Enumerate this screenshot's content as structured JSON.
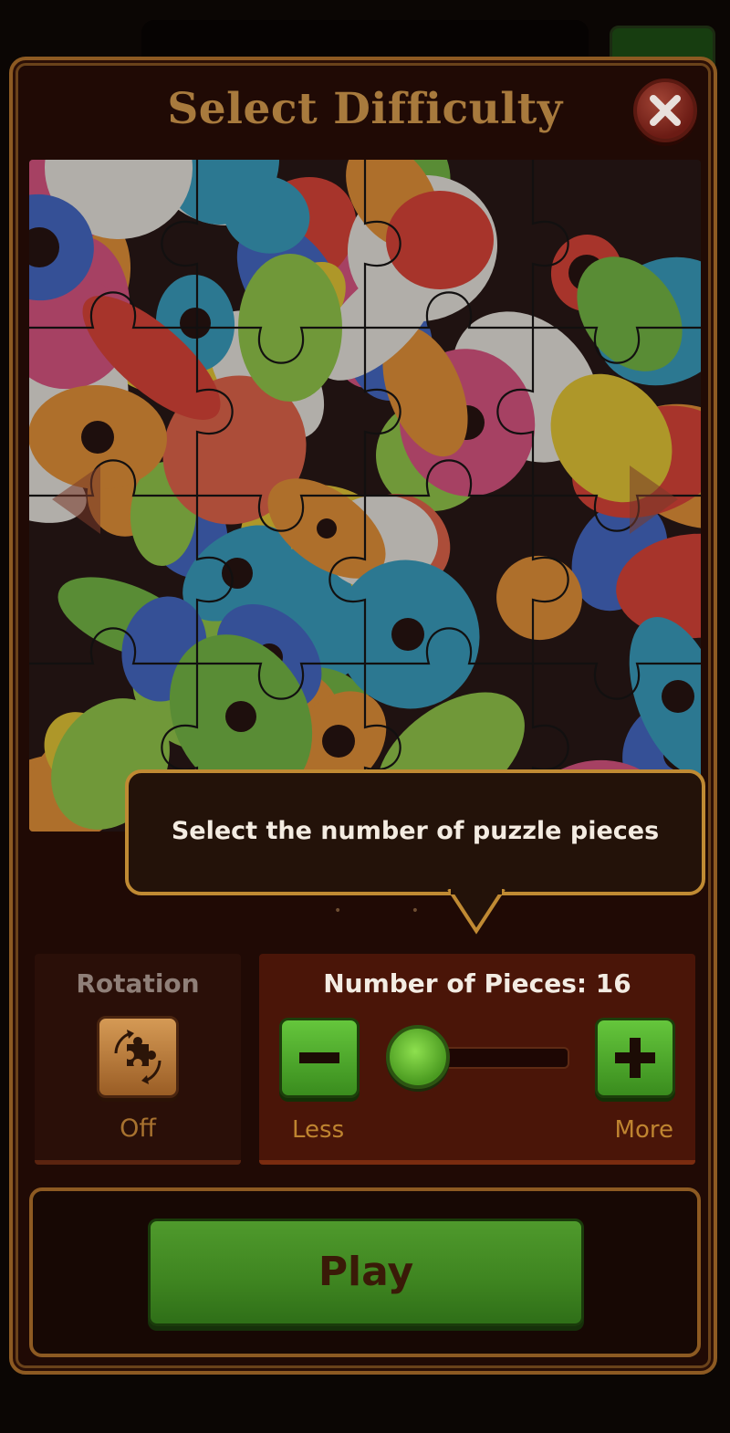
{
  "dialog": {
    "title": "Select Difficulty",
    "close_icon": "close-x-icon"
  },
  "puzzle_preview": {
    "description_icon": "candy-puzzle-image"
  },
  "tooltip": {
    "text": "Select the number of puzzle pieces"
  },
  "rotation": {
    "label": "Rotation",
    "icon": "rotate-piece-icon",
    "state": "Off"
  },
  "pieces": {
    "title": "Number of Pieces: 16",
    "minus_icon": "minus-icon",
    "plus_icon": "plus-icon",
    "less_label": "Less",
    "more_label": "More",
    "slider_level": 0.12
  },
  "play": {
    "label": "Play"
  },
  "colors": {
    "accent_gold": "#a87a3d",
    "button_green": "#4f9a2c",
    "panel_red": "#4a1508"
  }
}
